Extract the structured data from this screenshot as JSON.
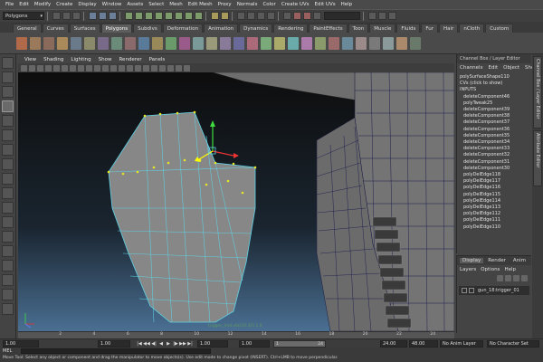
{
  "menubar": [
    "File",
    "Edit",
    "Modify",
    "Create",
    "Display",
    "Window",
    "Assets",
    "Select",
    "Mesh",
    "Edit Mesh",
    "Proxy",
    "Normals",
    "Color",
    "Create UVs",
    "Edit UVs",
    "Help"
  ],
  "statusline": {
    "mode": "Polygons"
  },
  "shelf_tabs": [
    "General",
    "Curves",
    "Surfaces",
    "Polygons",
    "Subdivs",
    "Deformation",
    "Animation",
    "Dynamics",
    "Rendering",
    "PaintEffects",
    "Toon",
    "Muscle",
    "Fluids",
    "Fur",
    "Hair",
    "nCloth",
    "Custom"
  ],
  "shelf_active": "Polygons",
  "viewport": {
    "menu": [
      "View",
      "Shading",
      "Lighting",
      "Show",
      "Renderer",
      "Panels"
    ],
    "axis_label": "trigger_mid.vtx[16:35] 1.0"
  },
  "channel_box": {
    "title": "Channel Box / Layer Editor",
    "tabs": [
      "Channels",
      "Edit",
      "Object",
      "Show"
    ],
    "shape": "polySurfaceShape110",
    "cvs": "CVs (click to show)",
    "inputs_label": "INPUTS",
    "nodes": [
      "deleteComponent46",
      "polyTweak25",
      "deleteComponent39",
      "deleteComponent38",
      "deleteComponent37",
      "deleteComponent36",
      "deleteComponent35",
      "deleteComponent34",
      "deleteComponent33",
      "deleteComponent32",
      "deleteComponent31",
      "deleteComponent30",
      "polyDelEdge118",
      "polyDelEdge117",
      "polyDelEdge116",
      "polyDelEdge115",
      "polyDelEdge114",
      "polyDelEdge113",
      "polyDelEdge112",
      "polyDelEdge111",
      "polyDelEdge110"
    ]
  },
  "side_tabs": [
    "Channel Box / Layer Editor",
    "Attribute Editor"
  ],
  "layer_editor": {
    "tabs": [
      "Display",
      "Render",
      "Anim"
    ],
    "menu": [
      "Layers",
      "Options",
      "Help"
    ],
    "layer_visibility": "V",
    "layer_name": "gun_18:trigger_01"
  },
  "time_slider": {
    "ticks": [
      "2",
      "4",
      "6",
      "8",
      "10",
      "12",
      "14",
      "16",
      "18",
      "20",
      "22",
      "24"
    ]
  },
  "range_bar": {
    "start": "1.00",
    "current": "1.00",
    "range_start": "1.00",
    "range_start_2": "1.00",
    "slider_start": "1",
    "slider_end": "24",
    "end_time": "24.00",
    "end_time_2": "48.00",
    "anim_layer": "No Anim Layer",
    "char_set": "No Character Set",
    "buttons": [
      "|◀",
      "◀◀",
      "◀|",
      "◀",
      "▶",
      "|▶",
      "▶▶",
      "▶|"
    ]
  },
  "command_line": {
    "label": "MEL"
  },
  "help_line": "Move Tool: Select any object or component and drag the manipulator to move objects(s). Use edit mode to change pivot (INSERT). Ctrl+LMB to move perpendicular."
}
